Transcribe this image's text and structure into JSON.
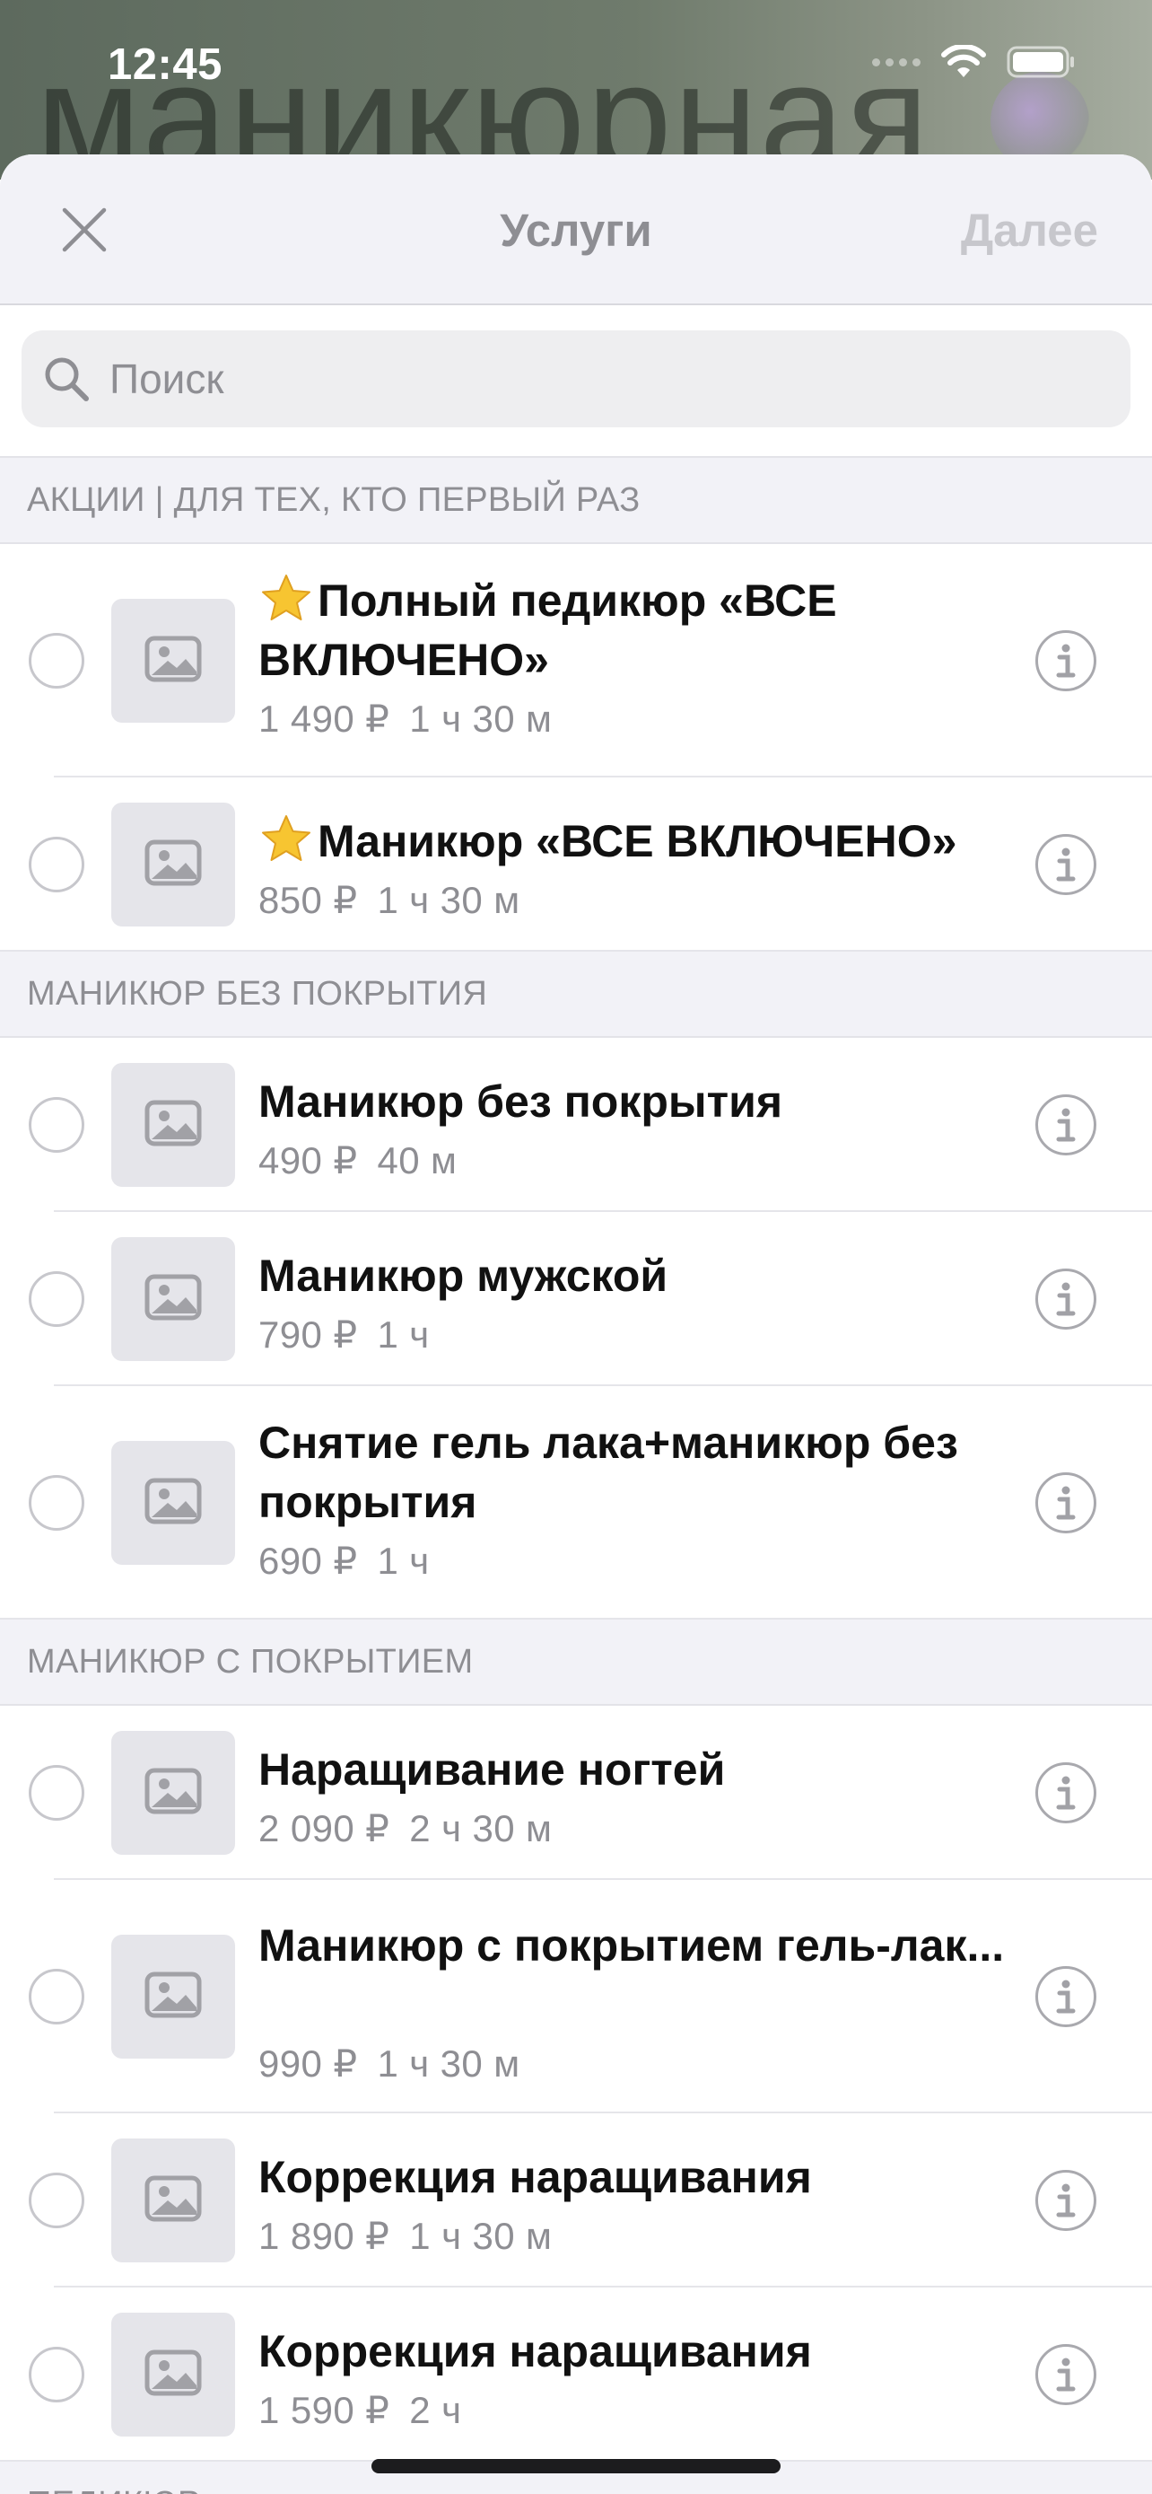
{
  "status_bar": {
    "time": "12:45"
  },
  "background": {
    "title_text": "маникюрная"
  },
  "nav": {
    "title": "Услуги",
    "next_label": "Далее"
  },
  "search": {
    "placeholder": "Поиск"
  },
  "sections": [
    {
      "title": "АКЦИИ | ДЛЯ ТЕХ, КТО ПЕРВЫЙ РАЗ",
      "items": [
        {
          "title": "Полный педикюр «ВСЕ ВКЛЮЧЕНО»",
          "price": "1 490 ₽",
          "duration": "1 ч 30 м",
          "star": true
        },
        {
          "title": "Маникюр «ВСЕ ВКЛЮЧЕНО»",
          "price": "850 ₽",
          "duration": "1 ч 30 м",
          "star": true
        }
      ]
    },
    {
      "title": "МАНИКЮР БЕЗ ПОКРЫТИЯ",
      "items": [
        {
          "title": "Маникюр без покрытия",
          "price": "490 ₽",
          "duration": "40 м"
        },
        {
          "title": "Маникюр мужской",
          "price": "790 ₽",
          "duration": "1 ч"
        },
        {
          "title": "Снятие гель лака+маникюр без покрытия",
          "price": "690 ₽",
          "duration": "1 ч"
        }
      ]
    },
    {
      "title": "МАНИКЮР С ПОКРЫТИЕМ",
      "items": [
        {
          "title": "Наращивание ногтей",
          "price": "2 090 ₽",
          "duration": "2 ч 30 м"
        },
        {
          "title": "Маникюр с покрытием гель-лак...",
          "price": "990 ₽",
          "duration": "1 ч 30 м"
        },
        {
          "title": "Коррекция наращивания",
          "price": "1 890 ₽",
          "duration": "1 ч 30 м"
        },
        {
          "title": "Коррекция наращивания",
          "price": "1 590 ₽",
          "duration": "2 ч"
        }
      ]
    },
    {
      "title": "ПЕДИКЮР",
      "items": []
    }
  ],
  "colors": {
    "sheet_background": "#ffffff",
    "header_background": "#f2f2f7",
    "secondary_text": "#8e8e93",
    "primary_text": "#111111",
    "star": "#f7c531"
  },
  "icons": {
    "close": "close-icon",
    "search": "search-icon",
    "thumbnail": "image-placeholder-icon",
    "info": "info-icon",
    "star": "star-icon",
    "wifi": "wifi-icon",
    "battery": "battery-icon"
  }
}
